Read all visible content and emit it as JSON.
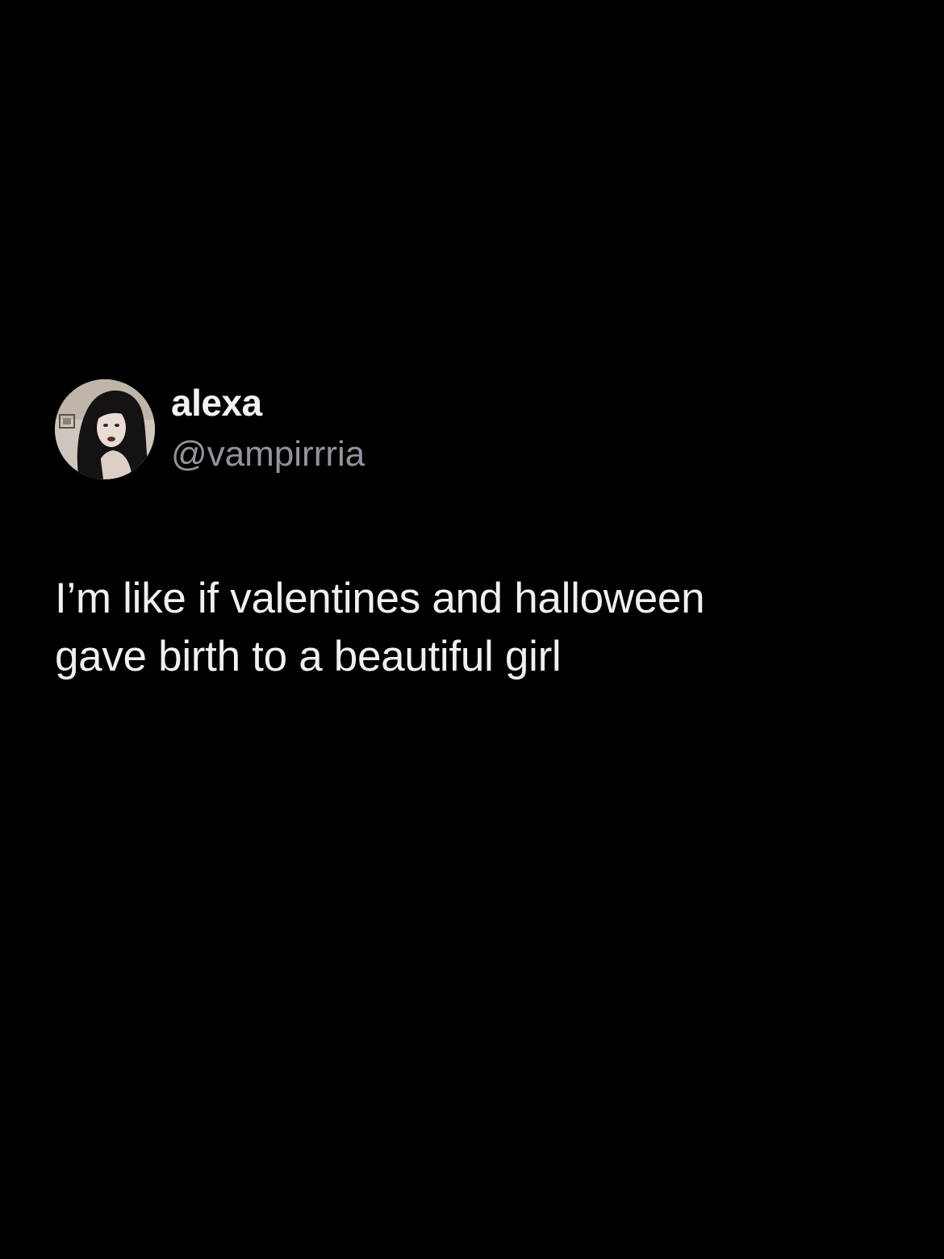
{
  "tweet": {
    "author": {
      "display_name": "alexa",
      "handle": "@vampirrria",
      "avatar_icon": "profile-photo"
    },
    "text": "I’m like if valentines and halloween\ngave birth to a beautiful girl"
  },
  "colors": {
    "background": "#000000",
    "primary_text": "#f0f0f0",
    "secondary_text": "#8f959b"
  }
}
